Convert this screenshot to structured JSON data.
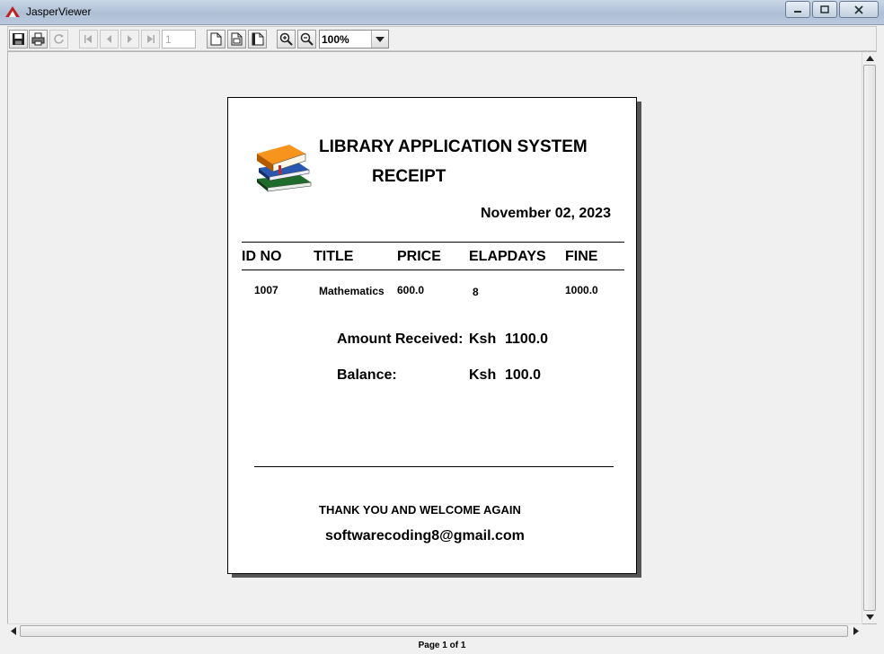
{
  "window": {
    "title": "JasperViewer"
  },
  "toolbar": {
    "page_number": "1",
    "zoom": "100%"
  },
  "report": {
    "title": "LIBRARY APPLICATION SYSTEM",
    "subtitle": "RECEIPT",
    "date": "November 02, 2023",
    "columns": [
      "ID NO",
      "TITLE",
      "PRICE",
      "ELAPDAYS",
      "FINE"
    ],
    "rows": [
      {
        "id_no": "1007",
        "title": "Mathematics",
        "price": "600.0",
        "elapdays": "8",
        "fine": "1000.0"
      }
    ],
    "amount_received_label": "Amount Received:",
    "amount_received_currency": "Ksh",
    "amount_received_value": "1100.0",
    "balance_label": "Balance:",
    "balance_currency": "Ksh",
    "balance_value": "100.0",
    "thanks": "THANK YOU AND WELCOME AGAIN",
    "email": "softwarecoding8@gmail.com"
  },
  "status": {
    "page_info": "Page 1 of 1"
  }
}
